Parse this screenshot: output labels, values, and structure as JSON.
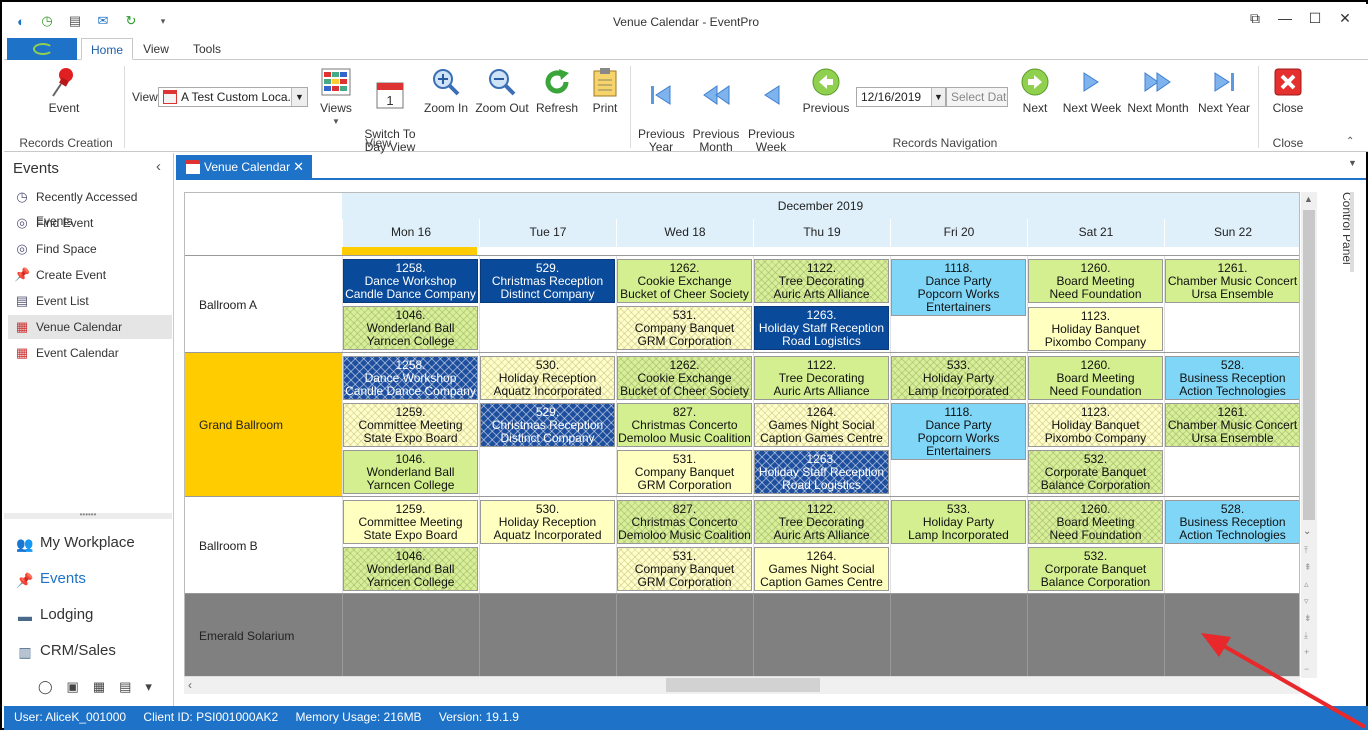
{
  "window": {
    "title": "Venue Calendar - EventPro"
  },
  "ribbon_tabs": [
    "Home",
    "View",
    "Tools"
  ],
  "ribbon": {
    "event_label": "Event",
    "records_creation": "Records Creation",
    "view_label": "View",
    "view_value": "A Test Custom Loca...",
    "views_label": "Views",
    "switch_label": "Switch To\nDay View",
    "zoom_in": "Zoom In",
    "zoom_out": "Zoom Out",
    "refresh": "Refresh",
    "print": "Print",
    "view_group": "View",
    "prev_year": "Previous\nYear",
    "prev_month": "Previous\nMonth",
    "prev_week": "Previous\nWeek",
    "previous": "Previous",
    "date_value": "12/16/2019",
    "select_date": "Select Date",
    "next": "Next",
    "next_week": "Next Week",
    "next_month": "Next Month",
    "next_year": "Next Year",
    "records_navigation": "Records Navigation",
    "close": "Close",
    "close_group": "Close"
  },
  "sidebar": {
    "title": "Events",
    "items": [
      {
        "label": "Recently Accessed Events",
        "icon": "clock-icon"
      },
      {
        "label": "Find Event",
        "icon": "binoculars-icon"
      },
      {
        "label": "Find Space",
        "icon": "binoculars-icon"
      },
      {
        "label": "Create Event",
        "icon": "pin-icon"
      },
      {
        "label": "Event List",
        "icon": "list-icon"
      },
      {
        "label": "Venue Calendar",
        "icon": "calendar-icon"
      },
      {
        "label": "Event Calendar",
        "icon": "calendar-icon"
      }
    ],
    "modules": [
      {
        "label": "My Workplace",
        "icon": "people-icon"
      },
      {
        "label": "Events",
        "icon": "pin-icon"
      },
      {
        "label": "Lodging",
        "icon": "bed-icon"
      },
      {
        "label": "CRM/Sales",
        "icon": "building-icon"
      }
    ]
  },
  "doc_tab": {
    "label": "Venue Calendar"
  },
  "calendar": {
    "month": "December 2019",
    "days": [
      "Mon 16",
      "Tue 17",
      "Wed 18",
      "Thu 19",
      "Fri 20",
      "Sat 21",
      "Sun 22"
    ],
    "rows": [
      {
        "name": "Ballroom A",
        "bg": "#ffffff",
        "height": 97,
        "events": [
          {
            "col": 0,
            "slot": 0,
            "type": "blue",
            "lines": [
              "1258.",
              "Dance Workshop",
              "Candle Dance Company"
            ]
          },
          {
            "col": 1,
            "slot": 0,
            "type": "blue",
            "lines": [
              "529.",
              "Christmas Reception",
              "Distinct Company"
            ]
          },
          {
            "col": 2,
            "slot": 0,
            "type": "green",
            "lines": [
              "1262.",
              "Cookie Exchange",
              "Bucket of Cheer Society"
            ]
          },
          {
            "col": 3,
            "slot": 0,
            "type": "greenhatch",
            "lines": [
              "1122.",
              "Tree Decorating",
              "Auric Arts Alliance"
            ]
          },
          {
            "col": 4,
            "slot": 0,
            "type": "cyan",
            "lines": [
              "1118.",
              "Dance Party",
              "Popcorn Works",
              "Entertainers"
            ],
            "tall": true
          },
          {
            "col": 5,
            "slot": 0,
            "type": "green",
            "lines": [
              "1260.",
              "Board Meeting",
              "Need Foundation"
            ]
          },
          {
            "col": 6,
            "slot": 0,
            "type": "green",
            "lines": [
              "1261.",
              "Chamber Music Concert",
              "Ursa Ensemble"
            ]
          },
          {
            "col": 0,
            "slot": 1,
            "type": "greenhatch",
            "lines": [
              "1046.",
              "Wonderland Ball",
              "Yarncen College"
            ]
          },
          {
            "col": 2,
            "slot": 1,
            "type": "yellowhatch",
            "lines": [
              "531.",
              "Company Banquet",
              "GRM Corporation"
            ]
          },
          {
            "col": 3,
            "slot": 1,
            "type": "blue",
            "lines": [
              "1263.",
              "Holiday Staff Reception",
              "Road Logistics"
            ]
          },
          {
            "col": 5,
            "slot": 1,
            "type": "yellow",
            "lines": [
              "1123.",
              "Holiday Banquet",
              "Pixombo Company"
            ],
            "offset": true
          }
        ]
      },
      {
        "name": "Grand Ballroom",
        "bg": "#ffcc00",
        "height": 144,
        "events": [
          {
            "col": 0,
            "slot": 0,
            "type": "bluehatch",
            "lines": [
              "1258.",
              "Dance Workshop",
              "Candle Dance Company"
            ]
          },
          {
            "col": 1,
            "slot": 0,
            "type": "yellowhatch",
            "lines": [
              "530.",
              "Holiday Reception",
              "Aquatz Incorporated"
            ]
          },
          {
            "col": 2,
            "slot": 0,
            "type": "greenhatch",
            "lines": [
              "1262.",
              "Cookie Exchange",
              "Bucket of Cheer Society"
            ]
          },
          {
            "col": 3,
            "slot": 0,
            "type": "green",
            "lines": [
              "1122.",
              "Tree Decorating",
              "Auric Arts Alliance"
            ]
          },
          {
            "col": 4,
            "slot": 0,
            "type": "greenhatch",
            "lines": [
              "533.",
              "Holiday Party",
              "Lamp Incorporated"
            ]
          },
          {
            "col": 5,
            "slot": 0,
            "type": "green",
            "lines": [
              "1260.",
              "Board Meeting",
              "Need Foundation"
            ]
          },
          {
            "col": 6,
            "slot": 0,
            "type": "cyan",
            "lines": [
              "528.",
              "Business Reception",
              "Action Technologies"
            ]
          },
          {
            "col": 0,
            "slot": 1,
            "type": "yellowhatch",
            "lines": [
              "1259.",
              "Committee Meeting",
              "State Expo Board"
            ]
          },
          {
            "col": 1,
            "slot": 1,
            "type": "bluehatch",
            "lines": [
              "529.",
              "Christmas Reception",
              "Distinct Company"
            ]
          },
          {
            "col": 2,
            "slot": 1,
            "type": "green",
            "lines": [
              "827.",
              "Christmas Concerto",
              "Demoloo Music Coalition"
            ]
          },
          {
            "col": 3,
            "slot": 1,
            "type": "yellowhatch",
            "lines": [
              "1264.",
              "Games Night Social",
              "Caption Games Centre"
            ]
          },
          {
            "col": 4,
            "slot": 1,
            "type": "cyan",
            "lines": [
              "1118.",
              "Dance Party",
              "Popcorn Works",
              "Entertainers"
            ],
            "tall": true
          },
          {
            "col": 5,
            "slot": 1,
            "type": "yellowhatch",
            "lines": [
              "1123.",
              "Holiday Banquet",
              "Pixombo Company"
            ]
          },
          {
            "col": 6,
            "slot": 1,
            "type": "greenhatch",
            "lines": [
              "1261.",
              "Chamber Music Concert",
              "Ursa Ensemble"
            ]
          },
          {
            "col": 0,
            "slot": 2,
            "type": "green",
            "lines": [
              "1046.",
              "Wonderland Ball",
              "Yarncen College"
            ]
          },
          {
            "col": 2,
            "slot": 2,
            "type": "yellow",
            "lines": [
              "531.",
              "Company Banquet",
              "GRM Corporation"
            ]
          },
          {
            "col": 3,
            "slot": 2,
            "type": "bluehatch",
            "lines": [
              "1263.",
              "Holiday Staff Reception",
              "Road Logistics"
            ]
          },
          {
            "col": 5,
            "slot": 2,
            "type": "greenhatch",
            "lines": [
              "532.",
              "Corporate Banquet",
              "Balance Corporation"
            ]
          }
        ]
      },
      {
        "name": "Ballroom B",
        "bg": "#ffffff",
        "height": 97,
        "events": [
          {
            "col": 0,
            "slot": 0,
            "type": "yellow",
            "lines": [
              "1259.",
              "Committee Meeting",
              "State Expo Board"
            ]
          },
          {
            "col": 1,
            "slot": 0,
            "type": "yellow",
            "lines": [
              "530.",
              "Holiday Reception",
              "Aquatz Incorporated"
            ]
          },
          {
            "col": 2,
            "slot": 0,
            "type": "greenhatch",
            "lines": [
              "827.",
              "Christmas Concerto",
              "Demoloo Music Coalition"
            ]
          },
          {
            "col": 3,
            "slot": 0,
            "type": "greenhatch",
            "lines": [
              "1122.",
              "Tree Decorating",
              "Auric Arts Alliance"
            ]
          },
          {
            "col": 4,
            "slot": 0,
            "type": "green",
            "lines": [
              "533.",
              "Holiday Party",
              "Lamp Incorporated"
            ]
          },
          {
            "col": 5,
            "slot": 0,
            "type": "greenhatch",
            "lines": [
              "1260.",
              "Board Meeting",
              "Need Foundation"
            ]
          },
          {
            "col": 6,
            "slot": 0,
            "type": "cyan",
            "lines": [
              "528.",
              "Business Reception",
              "Action Technologies"
            ]
          },
          {
            "col": 0,
            "slot": 1,
            "type": "greenhatch",
            "lines": [
              "1046.",
              "Wonderland Ball",
              "Yarncen College"
            ]
          },
          {
            "col": 2,
            "slot": 1,
            "type": "yellowhatch",
            "lines": [
              "531.",
              "Company Banquet",
              "GRM Corporation"
            ]
          },
          {
            "col": 3,
            "slot": 1,
            "type": "yellow",
            "lines": [
              "1264.",
              "Games Night Social",
              "Caption Games Centre"
            ]
          },
          {
            "col": 5,
            "slot": 1,
            "type": "green",
            "lines": [
              "532.",
              "Corporate Banquet",
              "Balance Corporation"
            ]
          }
        ]
      },
      {
        "name": "Emerald Solarium",
        "bg": "#808080",
        "height": 84,
        "events": []
      }
    ]
  },
  "control_panel": "Control Panel",
  "status": {
    "user": "User: AliceK_001000",
    "client": "Client ID: PSI001000AK2",
    "memory": "Memory Usage: 216MB",
    "version": "Version: 19.1.9"
  },
  "colors": {
    "accent": "#1e72c8",
    "annotation_arrow": "#e8282a"
  }
}
